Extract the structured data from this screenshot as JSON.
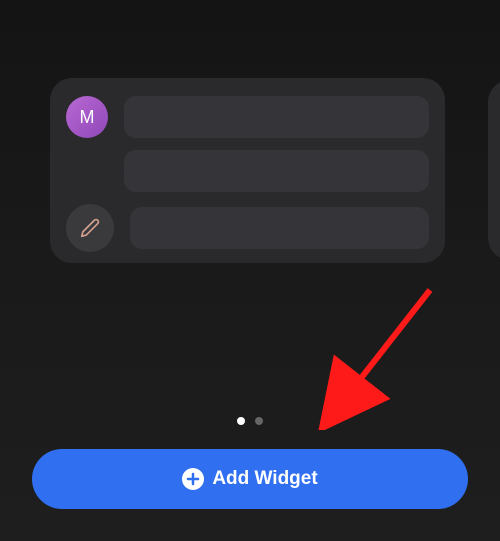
{
  "widget": {
    "avatar_initial": "M"
  },
  "pagination": {
    "current": 1,
    "total": 2
  },
  "button": {
    "add_widget_label": "Add Widget"
  },
  "colors": {
    "accent": "#2f6ff0",
    "avatar": "#a858c8",
    "card_bg": "#2a2a2d",
    "annotation_arrow": "#ff1a1a"
  }
}
